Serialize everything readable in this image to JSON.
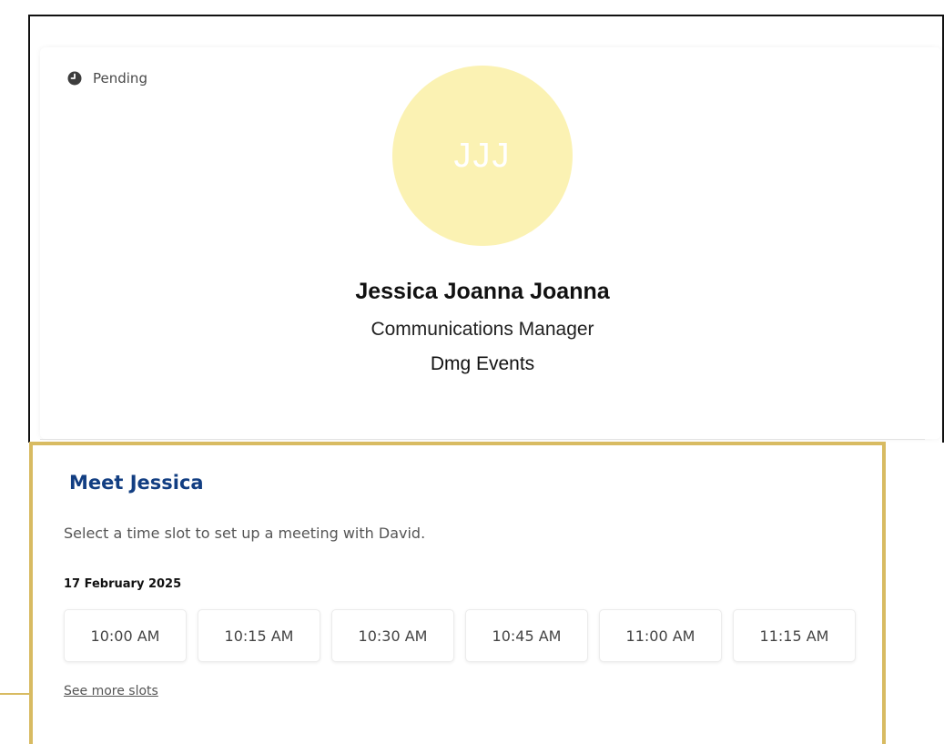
{
  "status": {
    "label": "Pending",
    "icon": "clock-icon"
  },
  "profile": {
    "initials": "JJJ",
    "avatar_color": "#fbf2b3",
    "name": "Jessica Joanna Joanna",
    "title": "Communications Manager",
    "company": "Dmg Events"
  },
  "meeting": {
    "heading": "Meet Jessica",
    "subtitle": "Select a time slot to set up a meeting with David.",
    "date": "17 February 2025",
    "slots": [
      "10:00 AM",
      "10:15 AM",
      "10:30 AM",
      "10:45 AM",
      "11:00 AM",
      "11:15 AM"
    ],
    "more_label": "See more slots",
    "heading_color": "#123e82"
  },
  "annotation": {
    "highlight_color": "#d8bb62",
    "outline_color": "#111111"
  }
}
